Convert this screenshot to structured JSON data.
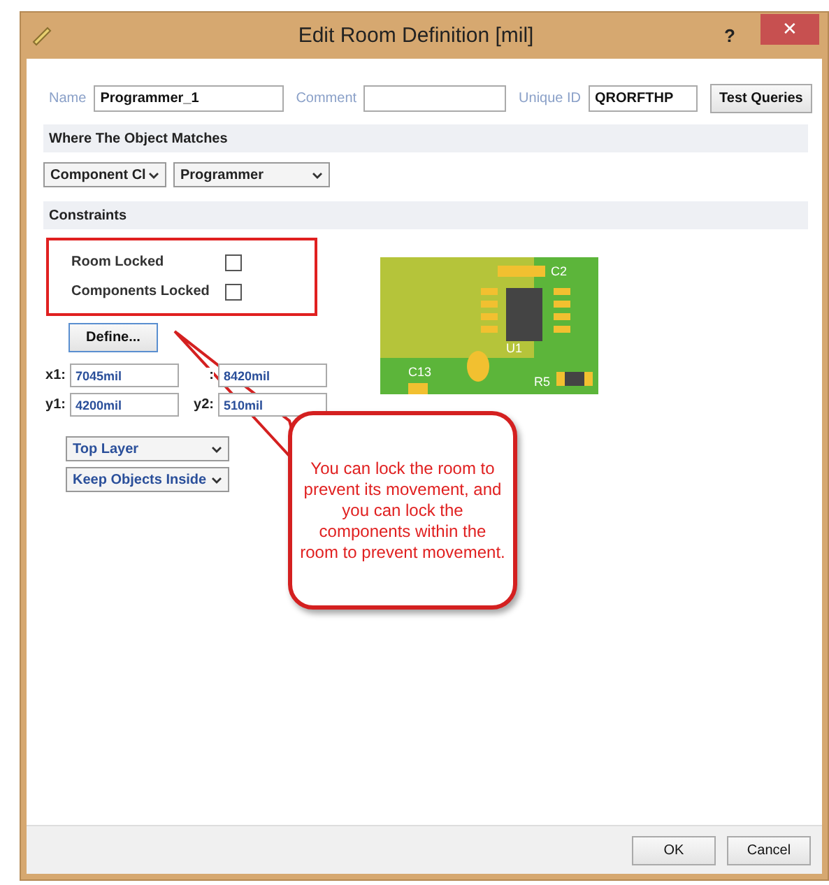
{
  "window": {
    "title": "Edit Room Definition [mil]",
    "help": "?",
    "close": "✕"
  },
  "fields": [
    {
      "label": "Name",
      "value": "Programmer_1"
    },
    {
      "label": "Comment"
    },
    {
      "label": "Unique ID",
      "value": "QRORFTHP"
    }
  ],
  "test_button": "Test Queries",
  "match_section": {
    "title": "Where The Object Matches",
    "dropdowns": [
      "Component Cl",
      "Programmer"
    ]
  },
  "constraints": {
    "title": "Constraints",
    "checks": [
      {
        "label": "Room Locked",
        "checked": false
      },
      {
        "label": "Components Locked",
        "checked": false
      }
    ],
    "define_button": "Define...",
    "coords": [
      {
        "label": "x1:",
        "value": "7045mil"
      },
      {
        "label": ":",
        "value": "8420mil"
      },
      {
        "label": "y1:",
        "value": "4200mil"
      },
      {
        "label": "y2:",
        "value": "510mil"
      }
    ],
    "dropdowns": [
      "Top Layer",
      "Keep Objects Inside"
    ],
    "pcb_labels": [
      "C2",
      "U1",
      "C13",
      "R5"
    ]
  },
  "callout": "You can lock the room to prevent its movement, and you can lock the components within the room to prevent movement.",
  "buttons": [
    "OK",
    "Cancel"
  ]
}
